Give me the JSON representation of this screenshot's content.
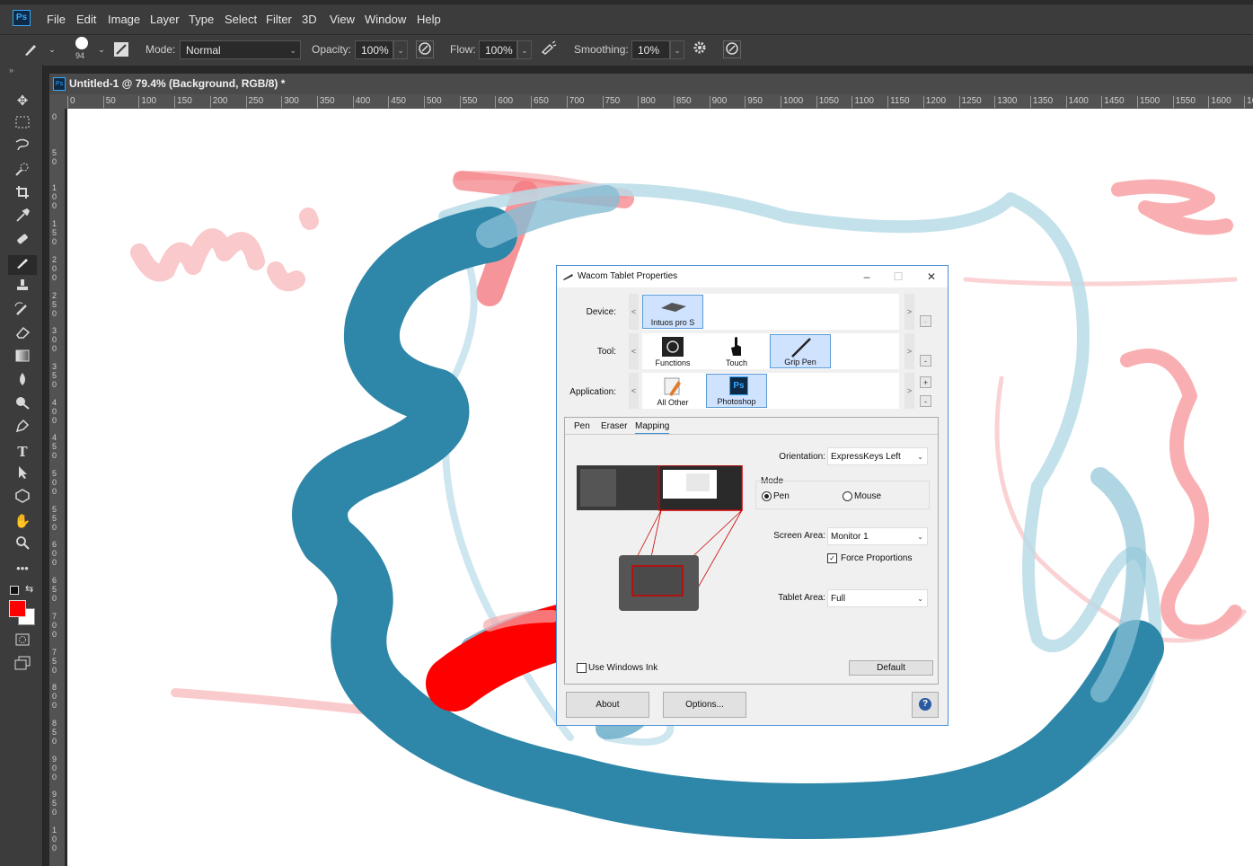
{
  "menu": {
    "logo": "Ps",
    "items": [
      "File",
      "Edit",
      "Image",
      "Layer",
      "Type",
      "Select",
      "Filter",
      "3D",
      "View",
      "Window",
      "Help"
    ]
  },
  "options": {
    "brush_size": "94",
    "mode_label": "Mode:",
    "mode_value": "Normal",
    "opacity_label": "Opacity:",
    "opacity_value": "100%",
    "flow_label": "Flow:",
    "flow_value": "100%",
    "smoothing_label": "Smoothing:",
    "smoothing_value": "10%"
  },
  "document": {
    "title": "Untitled-1 @ 79.4% (Background, RGB/8) *",
    "ruler_h": [
      "0",
      "50",
      "100",
      "150",
      "200",
      "250",
      "300",
      "350",
      "400",
      "450",
      "500",
      "550",
      "600",
      "650",
      "700",
      "750",
      "800",
      "850",
      "900",
      "950",
      "1000",
      "1050",
      "1100",
      "1150",
      "1200",
      "1250",
      "1300",
      "1350",
      "1400",
      "1450",
      "1500",
      "1550",
      "1600",
      "16"
    ],
    "ruler_v": [
      "0",
      "50",
      "100",
      "150",
      "200",
      "250",
      "300",
      "350",
      "400",
      "450",
      "500",
      "550",
      "600",
      "650",
      "700",
      "750",
      "800",
      "850",
      "900",
      "950",
      "100"
    ]
  },
  "colors": {
    "foreground": "#ff0000",
    "background": "#ffffff",
    "blue_stroke": "#2e86a8",
    "pink_stroke": "#f7a8ab"
  },
  "dialog": {
    "title": "Wacom Tablet Properties",
    "device_label": "Device:",
    "device_tile": "Intuos pro S",
    "tool_label": "Tool:",
    "tools": [
      "Functions",
      "Touch",
      "Grip Pen"
    ],
    "application_label": "Application:",
    "applications": [
      "All Other",
      "Photoshop"
    ],
    "tabs": [
      "Pen",
      "Eraser",
      "Mapping"
    ],
    "active_tab": "Mapping",
    "orientation_label": "Orientation:",
    "orientation_value": "ExpressKeys Left",
    "mode_group": "Mode",
    "mode_pen": "Pen",
    "mode_mouse": "Mouse",
    "screen_area_label": "Screen Area:",
    "screen_area_value": "Monitor 1",
    "force_proportions": "Force Proportions",
    "tablet_area_label": "Tablet Area:",
    "tablet_area_value": "Full",
    "use_windows_ink": "Use Windows Ink",
    "default_button": "Default",
    "about_button": "About",
    "options_button": "Options...",
    "help_glyph": "?",
    "ps_glyph": "Ps"
  }
}
